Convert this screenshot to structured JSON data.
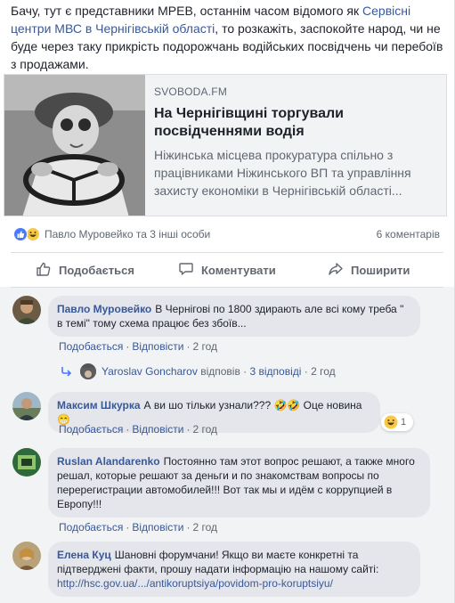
{
  "post": {
    "text_before": "Бачу, тут є представники МРЕВ, останнім часом відомого як ",
    "link_text": "Сервісні центри МВС в Чернігівській області",
    "text_after": ", то розкажіть, заспокойте народ, чи не буде через таку прикрість подорожчань водійських посвідчень чи перебоїв з продажами."
  },
  "link_preview": {
    "domain": "SVOBODA.FM",
    "title": "На Чернігівщині торгували посвідченнями водія",
    "description": "Ніжинська місцева прокуратура спільно з працівниками Ніжинського ВП та управління захисту економіки в Чернігівській області..."
  },
  "reactions": {
    "names": "Павло Муровейко та 3 інші особи",
    "comment_count": "6 коментарів",
    "icons": [
      "like-icon",
      "haha-icon"
    ]
  },
  "actions": {
    "like": "Подобається",
    "comment": "Коментувати",
    "share": "Поширити"
  },
  "comments": [
    {
      "author": "Павло Муровейко",
      "text": "В Чернігові по 1800 здирають але всі кому треба \" в темі\" тому схема працює без збоїв...",
      "like": "Подобається",
      "reply": "Відповісти",
      "time": "2 год"
    },
    {
      "author": "Максим Шкурка",
      "text": "А ви шо тільки узнали??? 🤣🤣 Оце новина😁",
      "like": "Подобається",
      "reply": "Відповісти",
      "time": "2 год",
      "reaction_count": "1"
    },
    {
      "author": "Ruslan Alandarenko",
      "text": "Постоянно там этот вопрос решают, а также много решал, которые решают за деньги и по знакомствам вопросы по перерегистрации автомобилей!!! Вот так мы и идём с коррупцией в Европу!!!",
      "like": "Подобається",
      "reply": "Відповісти",
      "time": "2 год"
    },
    {
      "author": "Елена Куц",
      "text": "Шановні форумчани! Якщо ви маєте конкретні та підтверджені факти, прошу надати інформацію на нашому сайті:",
      "link": "http://hsc.gov.ua/.../antikoruptsiya/povidom-pro-koruptsiyu/"
    }
  ],
  "reply_summary": {
    "author": "Yaroslav Goncharov",
    "verb": "відповів",
    "count": "3 відповіді",
    "time": "2 год"
  },
  "colors": {
    "link": "#385898",
    "secondary_text": "#606770",
    "bubble": "#e4e6eb",
    "like_blue": "#4a79ff"
  }
}
